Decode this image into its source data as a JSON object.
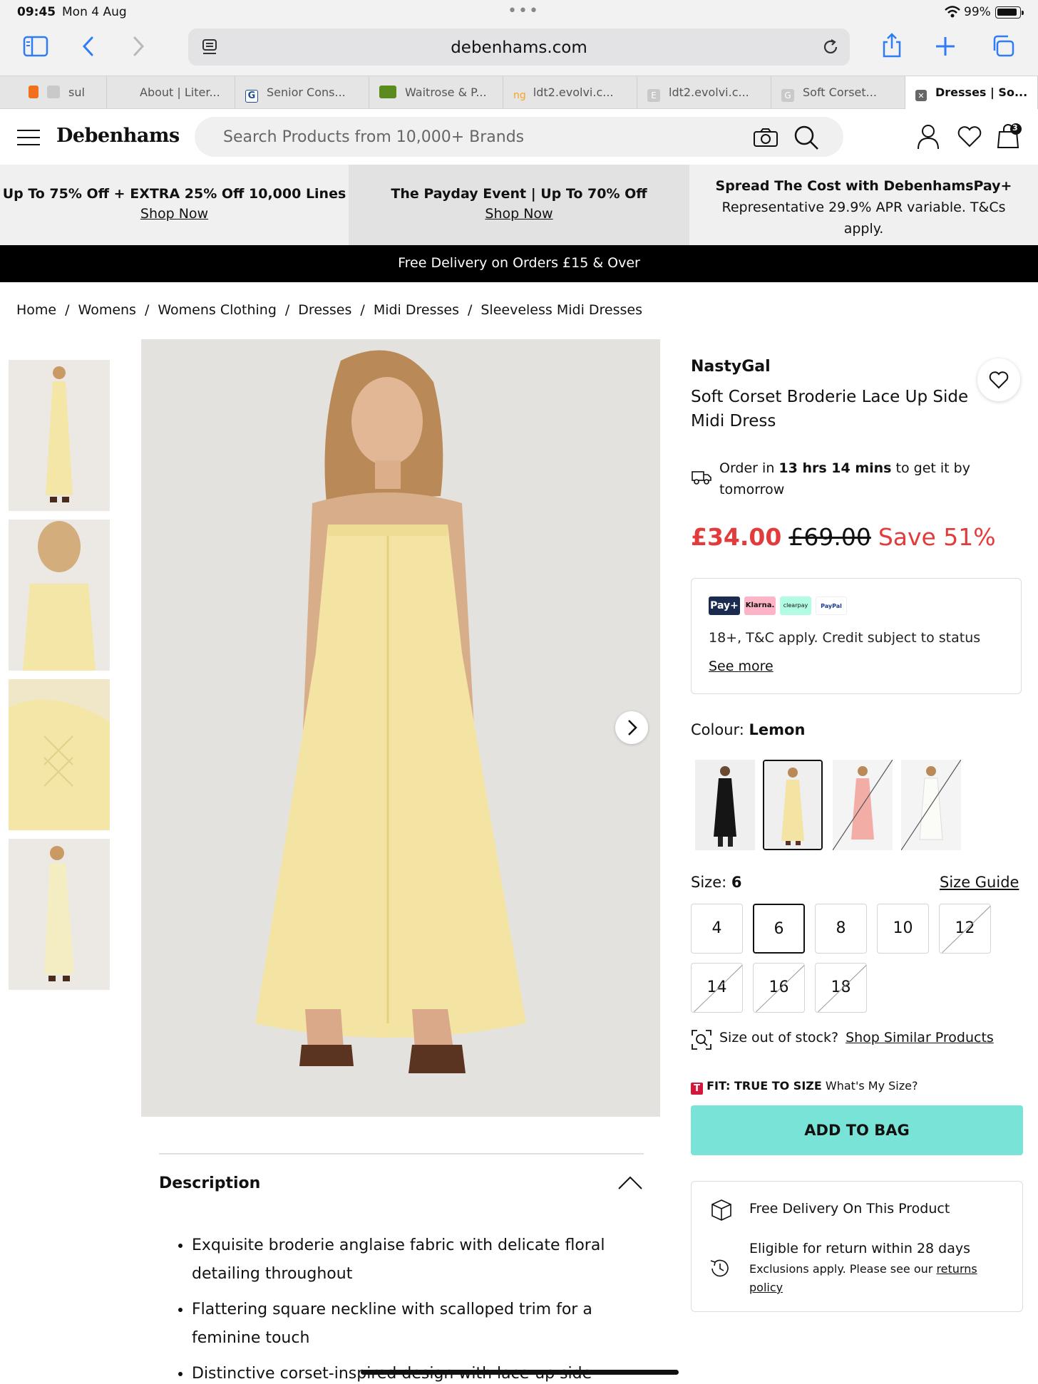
{
  "status": {
    "time": "09:45",
    "date": "Mon 4 Aug",
    "battery": "99%"
  },
  "browser": {
    "url": "debenhams.com"
  },
  "tabs": [
    {
      "label": "sul",
      "favicon": "#f2701d"
    },
    {
      "label": "About | Liter...",
      "favicon": ""
    },
    {
      "label": "Senior Cons...",
      "favicon": "#1f4e8c"
    },
    {
      "label": "Waitrose & P...",
      "favicon": "#5b8a1e"
    },
    {
      "label": "ldt2.evolvi.c...",
      "favicon": "#f5a623"
    },
    {
      "label": "ldt2.evolvi.c...",
      "favicon": "#bdbdbd"
    },
    {
      "label": "Soft Corset...",
      "favicon": "#bdbdbd"
    },
    {
      "label": "Dresses | So...",
      "favicon": "#555555"
    }
  ],
  "header": {
    "logo": "Debenhams",
    "search_placeholder": "Search Products from 10,000+ Brands",
    "bag_count": "3"
  },
  "promos": [
    {
      "title": "Up To 75% Off + EXTRA 25% Off 10,000 Lines",
      "link": "Shop Now"
    },
    {
      "title": "The Payday Event | Up To 70% Off",
      "link": "Shop Now"
    },
    {
      "title": "Spread The Cost with DebenhamsPay+",
      "body": "Representative 29.9% APR variable. T&Cs apply."
    }
  ],
  "delivery_bar": "Free Delivery on Orders £15 & Over",
  "breadcrumb": [
    "Home",
    "Womens",
    "Womens Clothing",
    "Dresses",
    "Midi Dresses",
    "Sleeveless Midi Dresses"
  ],
  "product": {
    "brand": "NastyGal",
    "name": "Soft Corset Broderie Lace Up Side Midi Dress",
    "order_prefix": "Order in",
    "order_time": "13 hrs 14 mins",
    "order_suffix": "to get it by tomorrow",
    "price_now": "£34.00",
    "price_was": "£69.00",
    "price_save": "Save 51%",
    "pay_logos": [
      "Pay+",
      "Klarna.",
      "clearpay",
      "PayPal"
    ],
    "pay_text": "18+, T&C apply. Credit subject to status",
    "pay_more": "See more",
    "colour_label": "Colour:",
    "colour_value": "Lemon",
    "size_label": "Size:",
    "size_value": "6",
    "size_guide": "Size Guide",
    "sizes": [
      "4",
      "6",
      "8",
      "10",
      "12",
      "14",
      "16",
      "18"
    ],
    "oos_text": "Size out of stock?",
    "oos_link": "Shop Similar Products",
    "fit_label": "FIT: TRUE TO SIZE",
    "fit_link": "What's My Size?",
    "add_to_bag": "ADD TO BAG",
    "delivery_line": "Free Delivery On This Product",
    "returns_line": "Eligible for return within 28 days",
    "returns_note": "Exclusions apply. Please see our",
    "returns_link": "returns policy"
  },
  "description": {
    "title": "Description",
    "bullets": [
      "Exquisite broderie anglaise fabric with delicate floral detailing throughout",
      "Flattering square neckline with scalloped trim for a feminine touch",
      "Distinctive corset-inspired design with lace-up side"
    ]
  },
  "colors": {
    "sale": "#e33b3b",
    "add_to_bag": "#7ae3d7",
    "accent_blue": "#2f7cf6"
  }
}
